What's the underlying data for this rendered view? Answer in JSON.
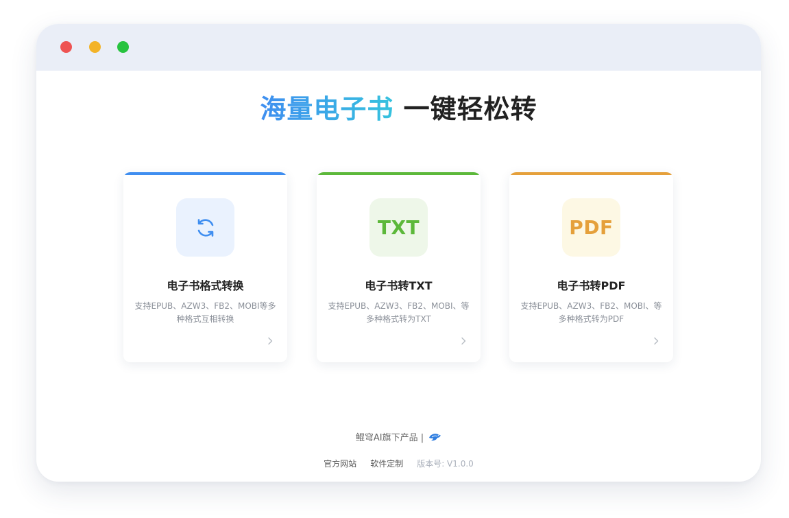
{
  "window": {
    "controls": [
      "close",
      "minimize",
      "maximize"
    ],
    "colors": {
      "close": "#ee5352",
      "minimize": "#f3b328",
      "maximize": "#27c33f"
    }
  },
  "headline": {
    "highlight": "海量电子书",
    "rest": "一键轻松转"
  },
  "cards": [
    {
      "title": "电子书格式转换",
      "description": "支持EPUB、AZW3、FB2、MOBI等多种格式互相转换",
      "icon": "refresh-icon",
      "accent": "#3f8ef0",
      "icon_bg": "#eaf2fe"
    },
    {
      "title": "电子书转TXT",
      "description": "支持EPUB、AZW3、FB2、MOBI、等多种格式转为TXT",
      "icon_text": "TXT",
      "accent": "#5cb83a",
      "icon_bg": "#eef7e9"
    },
    {
      "title": "电子书转PDF",
      "description": "支持EPUB、AZW3、FB2、MOBI、等多种格式转为PDF",
      "icon_text": "PDF",
      "accent": "#e5a03b",
      "icon_bg": "#fdf8e4"
    }
  ],
  "footer": {
    "brand": "鲲穹AI旗下产品 |",
    "brand_logo": "kunqiong-logo-icon",
    "links": [
      "官方网站",
      "软件定制"
    ],
    "version": "版本号: V1.0.0"
  }
}
